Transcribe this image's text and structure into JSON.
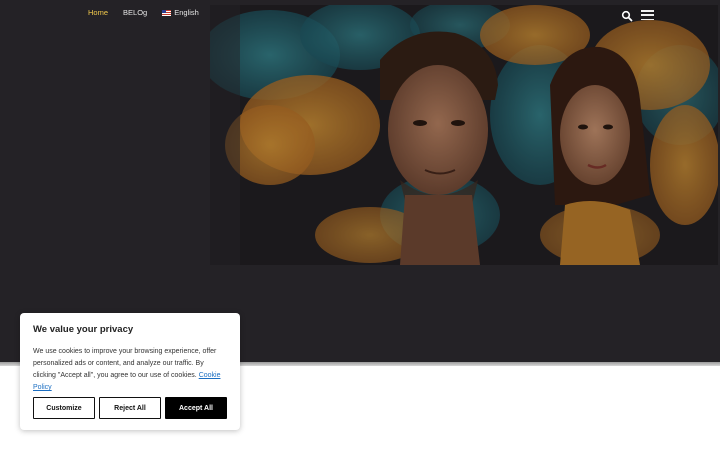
{
  "nav": {
    "items": [
      {
        "label": "Home",
        "active": true
      },
      {
        "label": "BELOg",
        "active": false
      },
      {
        "label": "English",
        "active": false,
        "icon": "us-flag-icon"
      }
    ],
    "search_icon": "search-icon",
    "menu_icon": "hamburger-menu-icon"
  },
  "colors": {
    "hero_background": "#242226",
    "active_nav": "#f2c94c",
    "link": "#1b6ec2"
  },
  "cookie": {
    "title": "We value your privacy",
    "body": "We use cookies to improve your browsing experience, offer personalized ads or content, and analyze our traffic. By clicking \"Accept all\", you agree to our use of cookies.",
    "policy_link": "Cookie Policy",
    "customize": "Customize",
    "reject": "Reject All",
    "accept": "Accept All"
  }
}
